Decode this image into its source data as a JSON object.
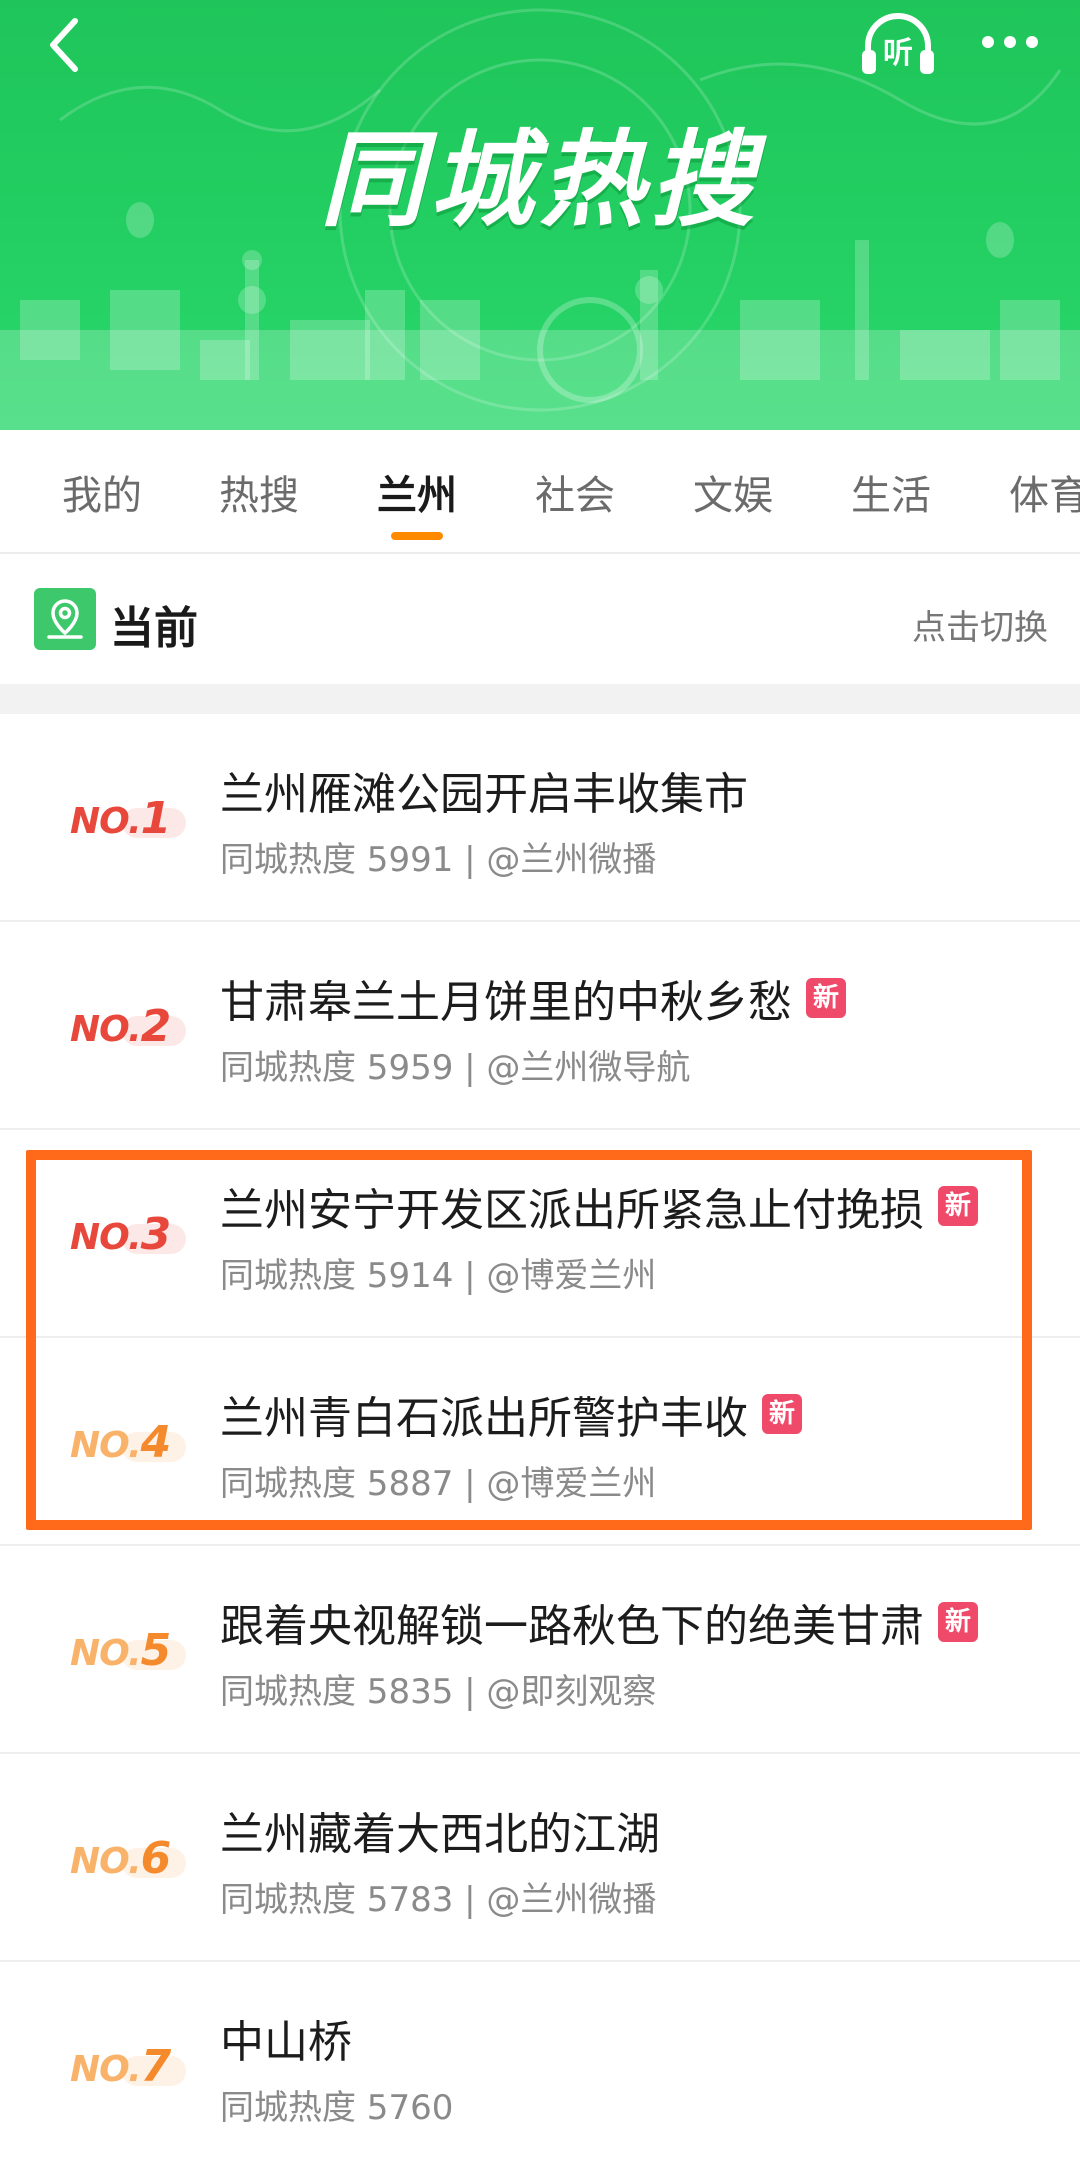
{
  "header": {
    "title": "同城热搜",
    "listen_label": "听",
    "icons": {
      "back": "back-icon",
      "listen": "headphones-icon",
      "more": "more-icon"
    }
  },
  "tabs": [
    {
      "label": "我的",
      "active": false
    },
    {
      "label": "热搜",
      "active": false
    },
    {
      "label": "兰州",
      "active": true
    },
    {
      "label": "社会",
      "active": false
    },
    {
      "label": "文娱",
      "active": false
    },
    {
      "label": "生活",
      "active": false
    },
    {
      "label": "体育",
      "active": false
    }
  ],
  "location": {
    "label": "当前",
    "switch_label": "点击切换",
    "icon": "location-pin-icon"
  },
  "items": [
    {
      "rank_no": "NO.",
      "rank_num": "1",
      "title": "兰州雁滩公园开启丰收集市",
      "meta": "同城热度 5991 | @兰州微播",
      "badge": ""
    },
    {
      "rank_no": "NO.",
      "rank_num": "2",
      "title": "甘肃皋兰土月饼里的中秋乡愁",
      "meta": "同城热度 5959 | @兰州微导航",
      "badge": "新"
    },
    {
      "rank_no": "NO.",
      "rank_num": "3",
      "title": "兰州安宁开发区派出所紧急止付挽损",
      "meta": "同城热度 5914 | @博爱兰州",
      "badge": "新"
    },
    {
      "rank_no": "NO.",
      "rank_num": "4",
      "title": "兰州青白石派出所警护丰收",
      "meta": "同城热度 5887 | @博爱兰州",
      "badge": "新"
    },
    {
      "rank_no": "NO.",
      "rank_num": "5",
      "title": "跟着央视解锁一路秋色下的绝美甘肃",
      "meta": "同城热度 5835 | @即刻观察",
      "badge": "新"
    },
    {
      "rank_no": "NO.",
      "rank_num": "6",
      "title": "兰州藏着大西北的江湖",
      "meta": "同城热度 5783 | @兰州微播",
      "badge": ""
    },
    {
      "rank_no": "NO.",
      "rank_num": "7",
      "title": "中山桥",
      "meta": "同城热度 5760",
      "badge": ""
    }
  ],
  "colors": {
    "banner_green": "#23cf62",
    "tab_indicator": "#ff8a00",
    "highlight_border": "#ff6a1a",
    "new_badge": "#f04a6b",
    "rank_red": "#e8483c",
    "rank_orange": "#f58a2c",
    "rank_light": "#f9b26a"
  }
}
